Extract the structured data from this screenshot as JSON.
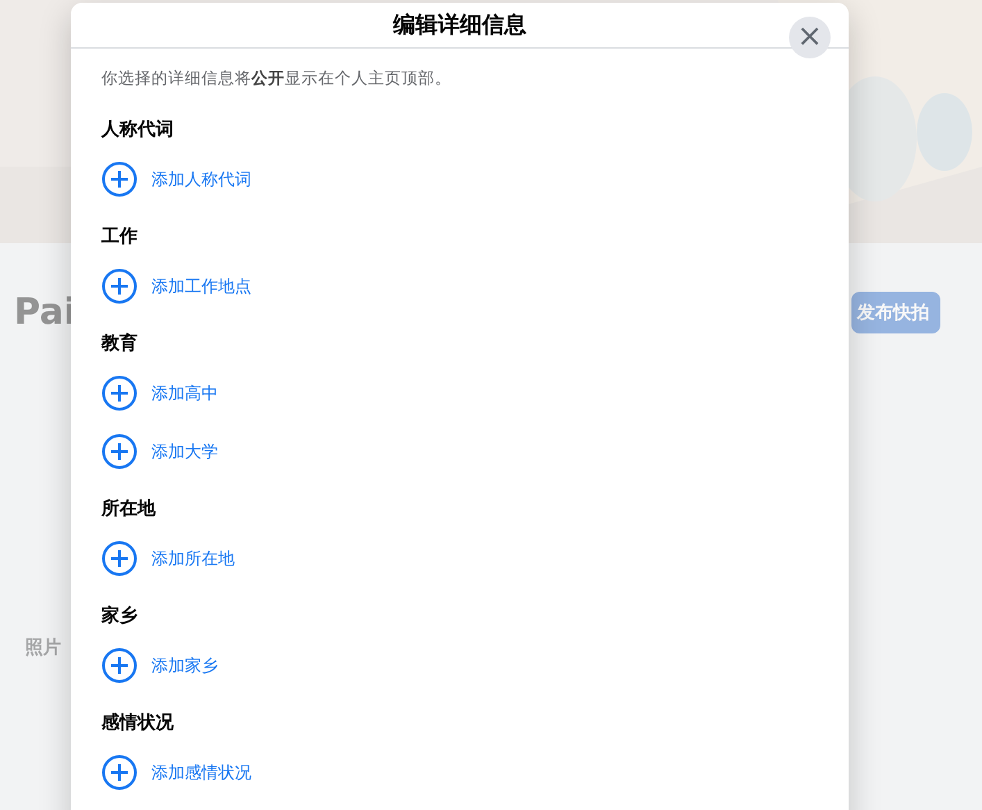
{
  "backdrop": {
    "profile_name": "Pai",
    "story_button": "发布快拍",
    "photos_tab": "照片"
  },
  "dialog": {
    "title": "编辑详细信息",
    "close_label": "×",
    "notice": "你选择的详细信息将**公开**显示在个人主页顶部。",
    "sections": [
      {
        "heading": "人称代词",
        "items": [
          "添加人称代词"
        ]
      },
      {
        "heading": "工作",
        "items": [
          "添加工作地点"
        ]
      },
      {
        "heading": "教育",
        "items": [
          "添加高中",
          "添加大学"
        ]
      },
      {
        "heading": "所在地",
        "items": [
          "添加所在地"
        ]
      },
      {
        "heading": "家乡",
        "items": [
          "添加家乡"
        ]
      },
      {
        "heading": "感情状况",
        "items": [
          "添加感情状况"
        ]
      }
    ]
  }
}
